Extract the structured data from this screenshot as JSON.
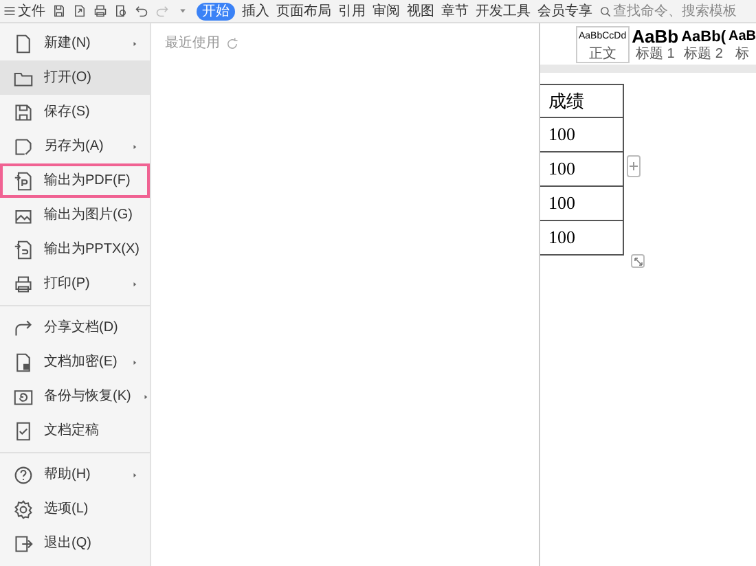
{
  "toolbar": {
    "file_menu": "文件",
    "tabs": [
      {
        "label": "开始",
        "selected": true
      },
      {
        "label": "插入",
        "selected": false
      },
      {
        "label": "页面布局",
        "selected": false
      },
      {
        "label": "引用",
        "selected": false
      },
      {
        "label": "审阅",
        "selected": false
      },
      {
        "label": "视图",
        "selected": false
      },
      {
        "label": "章节",
        "selected": false
      },
      {
        "label": "开发工具",
        "selected": false
      },
      {
        "label": "会员专享",
        "selected": false
      }
    ],
    "search": {
      "placeholder": "查找命令、搜索模板"
    }
  },
  "file_menu": {
    "items": [
      {
        "label": "新建(N)",
        "selected": false,
        "highlighted": false,
        "submenu": true
      },
      {
        "label": "打开(O)",
        "selected": true,
        "highlighted": false,
        "submenu": false
      },
      {
        "label": "保存(S)",
        "selected": false,
        "highlighted": false,
        "submenu": false
      },
      {
        "label": "另存为(A)",
        "selected": false,
        "highlighted": false,
        "submenu": true
      },
      {
        "label": "输出为PDF(F)",
        "selected": false,
        "highlighted": true,
        "submenu": false
      },
      {
        "label": "输出为图片(G)",
        "selected": false,
        "highlighted": false,
        "submenu": false
      },
      {
        "label": "输出为PPTX(X)",
        "selected": false,
        "highlighted": false,
        "submenu": false
      },
      {
        "label": "打印(P)",
        "selected": false,
        "highlighted": false,
        "submenu": true,
        "divider_after": true
      },
      {
        "label": "分享文档(D)",
        "selected": false,
        "highlighted": false,
        "submenu": false
      },
      {
        "label": "文档加密(E)",
        "selected": false,
        "highlighted": false,
        "submenu": true
      },
      {
        "label": "备份与恢复(K)",
        "selected": false,
        "highlighted": false,
        "submenu": true
      },
      {
        "label": "文档定稿",
        "selected": false,
        "highlighted": false,
        "submenu": false,
        "divider_after": true
      },
      {
        "label": "帮助(H)",
        "selected": false,
        "highlighted": false,
        "submenu": true
      },
      {
        "label": "选项(L)",
        "selected": false,
        "highlighted": false,
        "submenu": false
      },
      {
        "label": "退出(Q)",
        "selected": false,
        "highlighted": false,
        "submenu": false
      }
    ]
  },
  "recent": {
    "title": "最近使用"
  },
  "styles": [
    {
      "sample": "AaBbCcDd",
      "label": "正文",
      "kind": "body"
    },
    {
      "sample": "AaBb",
      "label": "标题 1",
      "kind": "heading1"
    },
    {
      "sample": "AaBb(",
      "label": "标题 2",
      "kind": "heading2"
    },
    {
      "sample": "AaB",
      "label": "标",
      "kind": "heading3"
    }
  ],
  "table": {
    "column_header": "成绩",
    "rows": [
      "100",
      "100",
      "100",
      "100"
    ]
  }
}
